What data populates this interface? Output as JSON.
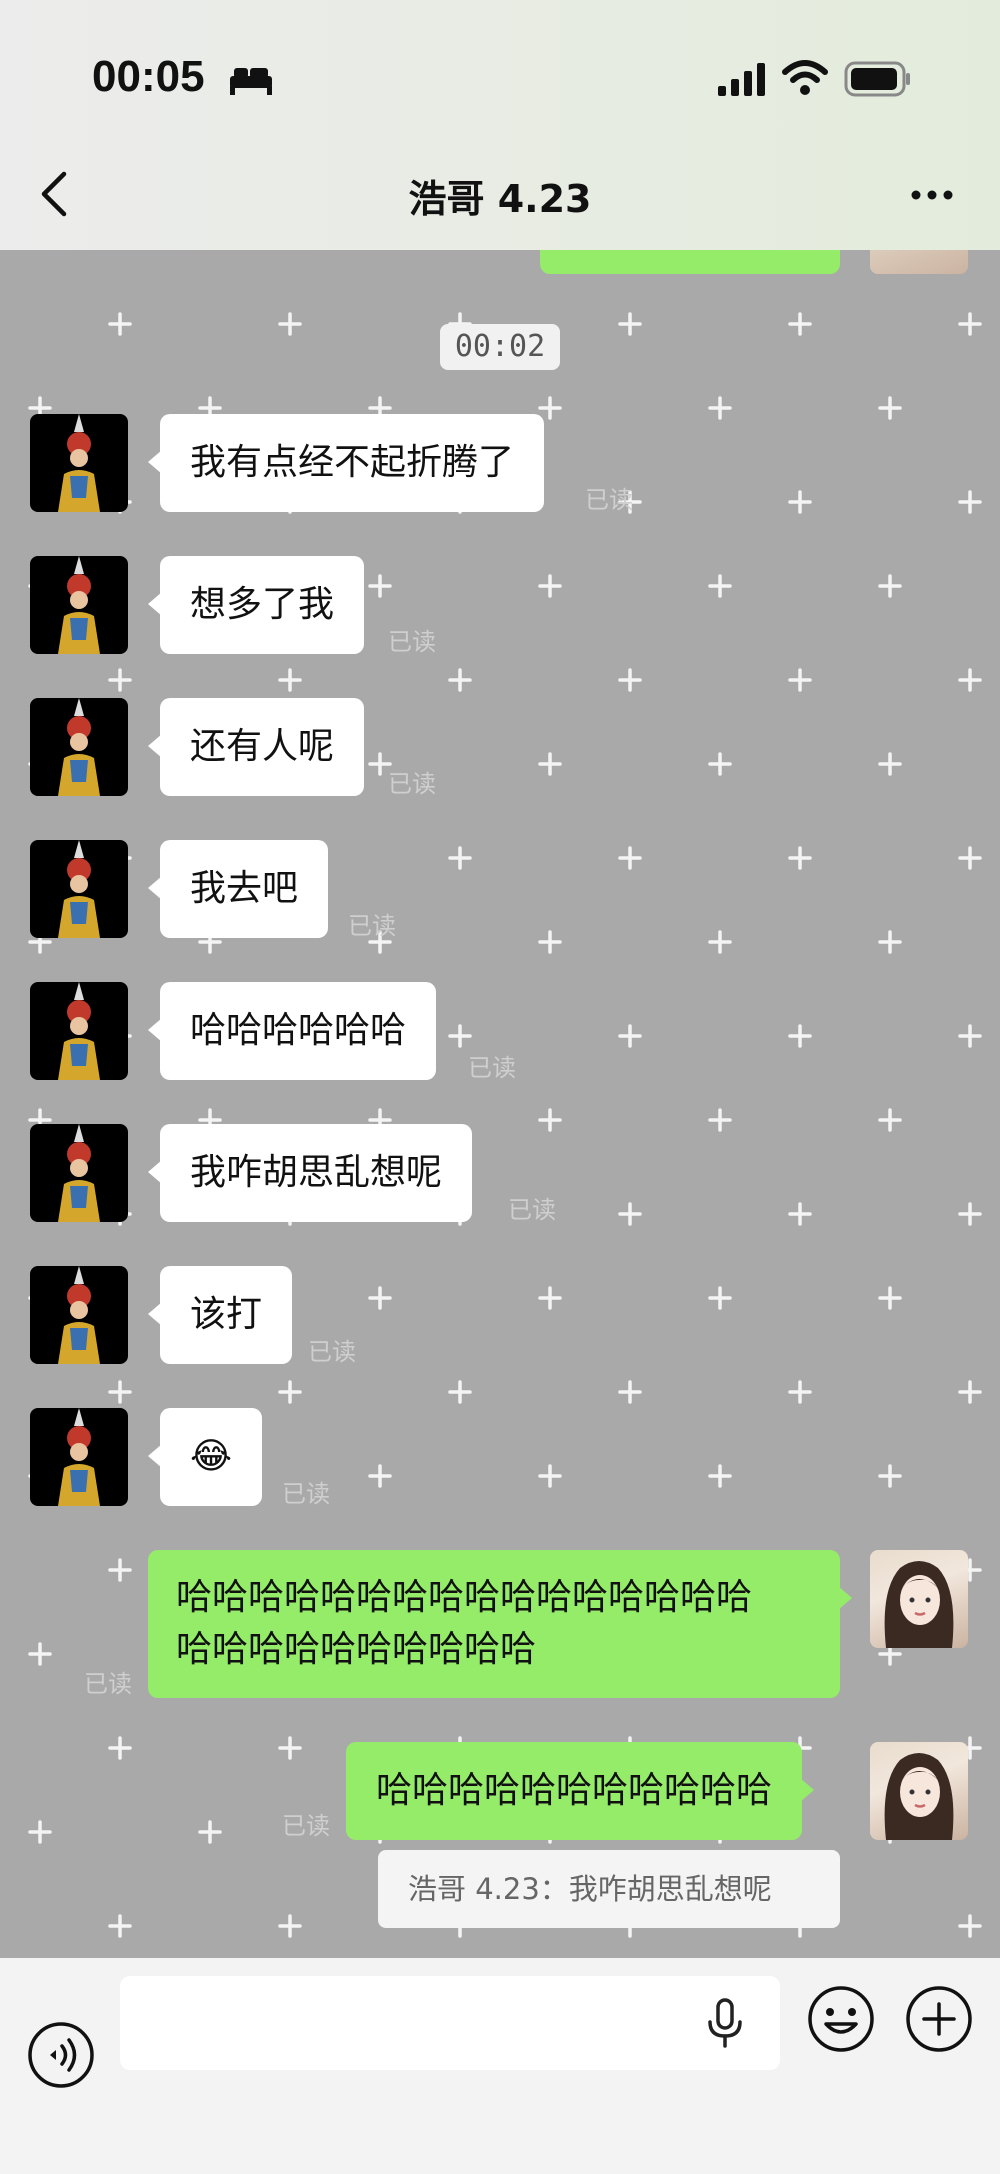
{
  "status_bar": {
    "time": "00:05",
    "icons": [
      "bed-icon",
      "signal-icon",
      "wifi-icon",
      "battery-icon"
    ]
  },
  "nav": {
    "title": "浩哥 4.23",
    "back_icon": "chevron-left-icon",
    "more_icon": "more-icon"
  },
  "chat": {
    "timestamp": "00:02",
    "read_label": "已读",
    "received": [
      {
        "text": "我有点经不起折腾了"
      },
      {
        "text": "想多了我"
      },
      {
        "text": "还有人呢"
      },
      {
        "text": "我去吧"
      },
      {
        "text": "哈哈哈哈哈哈"
      },
      {
        "text": "我咋胡思乱想呢"
      },
      {
        "text": "该打"
      },
      {
        "text": "😂"
      }
    ],
    "sent": [
      {
        "line1": "哈哈哈哈哈哈哈哈哈哈哈哈哈哈哈哈",
        "line2": "哈哈哈哈哈哈哈哈哈哈"
      },
      {
        "text": "哈哈哈哈哈哈哈哈哈哈哈"
      }
    ],
    "quote": "浩哥 4.23：我咋胡思乱想呢"
  },
  "input_bar": {
    "icons": [
      "voice-toggle-icon",
      "mic-icon",
      "emoji-icon",
      "plus-icon"
    ]
  },
  "colors": {
    "chat_bg": "#a9a9a9",
    "sent_bubble": "#95ec69",
    "received_bubble": "#ffffff",
    "read_text": "#cfcfcf"
  }
}
